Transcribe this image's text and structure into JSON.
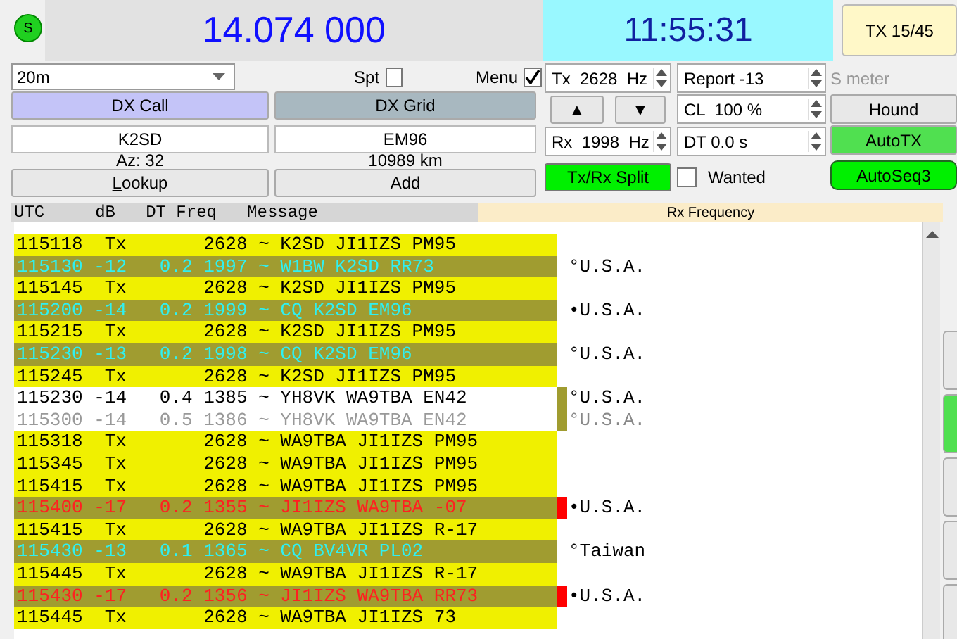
{
  "top_bar": {
    "status": "S",
    "frequency": "14.074 000",
    "clock": "11:55:31",
    "tx_period": "TX 15/45"
  },
  "controls": {
    "band": "20m",
    "spot": {
      "label": "Spt",
      "checked": false
    },
    "menu": {
      "label": "Menu",
      "checked": true
    },
    "dx_call_label": "DX Call",
    "dx_grid_label": "DX Grid",
    "dx_call": "K2SD",
    "dx_grid": "EM96",
    "azimuth": "Az: 32",
    "distance": "10989 km",
    "lookup": "Lookup",
    "add": "Add",
    "tx_freq": "Tx  2628  Hz",
    "report": "Report -13",
    "s_meter": "S meter",
    "up": "▲",
    "down": "▼",
    "cl": "CL  100 %",
    "rx_freq": "Rx  1998  Hz",
    "dt": "DT 0.0 s",
    "split": {
      "label": "Tx/Rx Split",
      "on": true
    },
    "wanted": {
      "label": "Wanted",
      "checked": false
    },
    "side_buttons": [
      {
        "label": "Hound",
        "on": false,
        "rounded": false
      },
      {
        "label": "AutoTX",
        "on": true,
        "rounded": false
      },
      {
        "label": "AutoSeq3",
        "on": true,
        "rounded": true
      }
    ]
  },
  "table": {
    "columns": [
      "UTC",
      "dB",
      "DT",
      "Freq",
      "Message"
    ],
    "rx_header": "Rx Frequency",
    "rows": [
      {
        "kind": "tx",
        "utc": "115118",
        "db": "Tx",
        "freq": "2628",
        "message": "~ K2SD JI1IZS PM95"
      },
      {
        "kind": "cq",
        "utc": "115130",
        "db": "-12",
        "dt": "0.2",
        "freq": "1997",
        "message": "~ W1BW K2SD RR73",
        "country": "°U.S.A."
      },
      {
        "kind": "tx",
        "utc": "115145",
        "db": "Tx",
        "freq": "2628",
        "message": "~ K2SD JI1IZS PM95"
      },
      {
        "kind": "cq",
        "utc": "115200",
        "db": "-14",
        "dt": "0.2",
        "freq": "1999",
        "message": "~ CQ K2SD EM96",
        "country": "•U.S.A."
      },
      {
        "kind": "tx",
        "utc": "115215",
        "db": "Tx",
        "freq": "2628",
        "message": "~ K2SD JI1IZS PM95"
      },
      {
        "kind": "cq",
        "utc": "115230",
        "db": "-13",
        "dt": "0.2",
        "freq": "1998",
        "message": "~ CQ K2SD EM96",
        "country": "°U.S.A."
      },
      {
        "kind": "tx",
        "utc": "115245",
        "db": "Tx",
        "freq": "2628",
        "message": "~ K2SD JI1IZS PM95"
      },
      {
        "kind": "plain",
        "utc": "115230",
        "db": "-14",
        "dt": "0.4",
        "freq": "1385",
        "message": "~ YH8VK WA9TBA EN42",
        "country": "°U.S.A.",
        "color": "#a09c30"
      },
      {
        "kind": "faded",
        "utc": "115300",
        "db": "-14",
        "dt": "0.5",
        "freq": "1386",
        "message": "~ YH8VK WA9TBA EN42",
        "country": "°U.S.A.",
        "color": "#a09c30"
      },
      {
        "kind": "tx",
        "utc": "115318",
        "db": "Tx",
        "freq": "2628",
        "message": "~ WA9TBA JI1IZS PM95"
      },
      {
        "kind": "tx",
        "utc": "115345",
        "db": "Tx",
        "freq": "2628",
        "message": "~ WA9TBA JI1IZS PM95"
      },
      {
        "kind": "tx",
        "utc": "115415",
        "db": "Tx",
        "freq": "2628",
        "message": "~ WA9TBA JI1IZS PM95"
      },
      {
        "kind": "call",
        "utc": "115400",
        "db": "-17",
        "dt": "0.2",
        "freq": "1355",
        "message": "~ JI1IZS WA9TBA -07",
        "country": "•U.S.A.",
        "color": "#ff0000"
      },
      {
        "kind": "tx",
        "utc": "115415",
        "db": "Tx",
        "freq": "2628",
        "message": "~ WA9TBA JI1IZS R-17"
      },
      {
        "kind": "cq",
        "utc": "115430",
        "db": "-13",
        "dt": "0.1",
        "freq": "1365",
        "message": "~ CQ BV4VR PL02",
        "country": "°Taiwan"
      },
      {
        "kind": "tx",
        "utc": "115445",
        "db": "Tx",
        "freq": "2628",
        "message": "~ WA9TBA JI1IZS R-17"
      },
      {
        "kind": "call",
        "utc": "115430",
        "db": "-17",
        "dt": "0.2",
        "freq": "1356",
        "message": "~ JI1IZS WA9TBA RR73",
        "country": "•U.S.A.",
        "color": "#ff0000"
      },
      {
        "kind": "tx",
        "utc": "115445",
        "db": "Tx",
        "freq": "2628",
        "message": "~ WA9TBA JI1IZS 73"
      }
    ]
  }
}
